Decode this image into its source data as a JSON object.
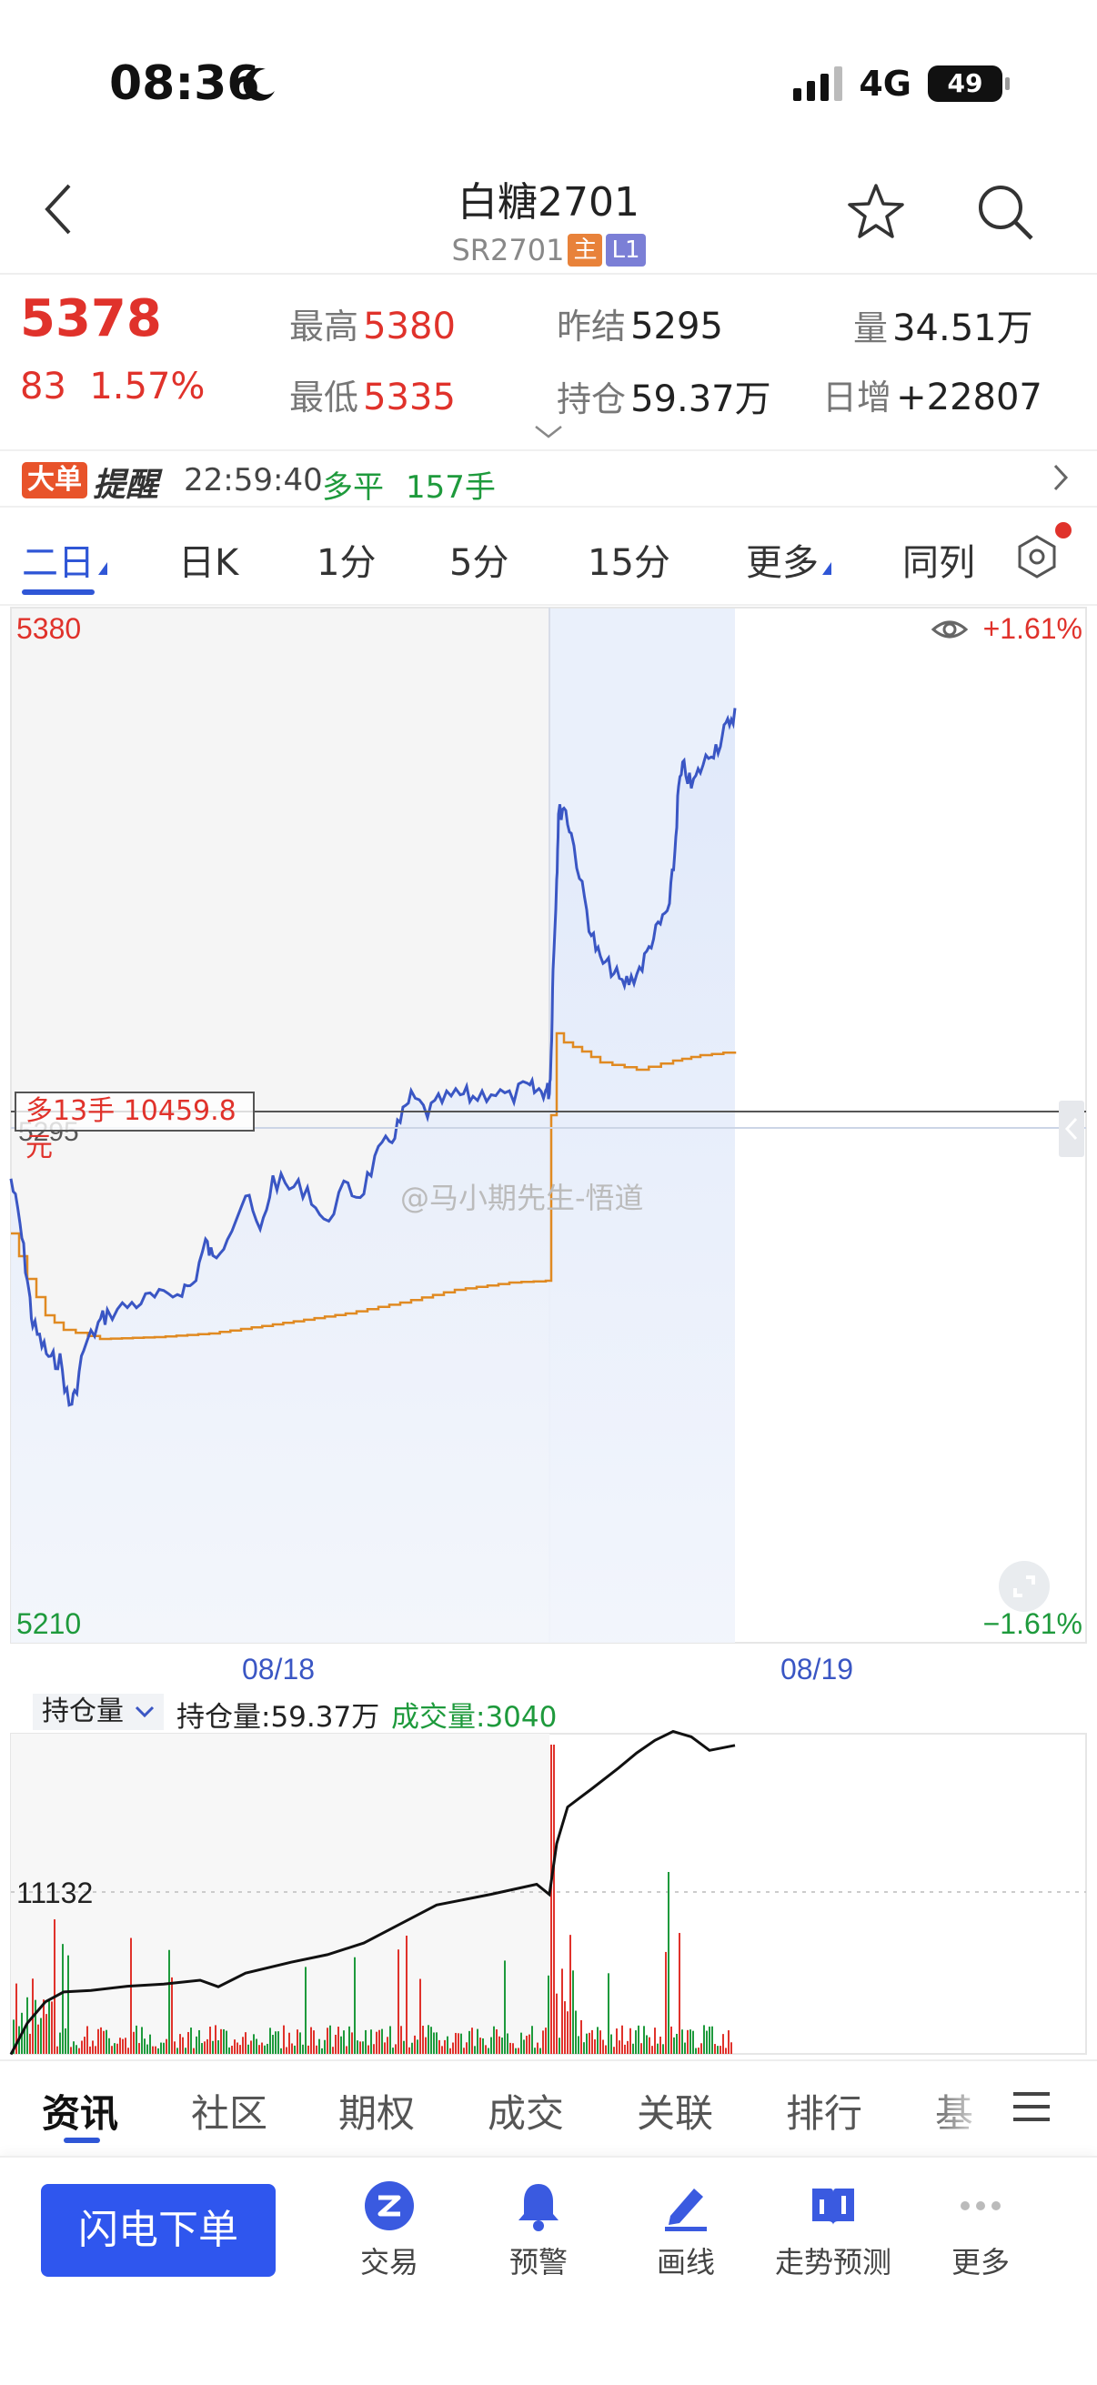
{
  "status": {
    "time": "08:36",
    "network": "4G",
    "battery": "49"
  },
  "header": {
    "title": "白糖2701",
    "code": "SR2701",
    "tag_main": "主",
    "tag_level": "L1"
  },
  "quote": {
    "price": "5378",
    "change": "83",
    "change_pct": "1.57%",
    "high_label": "最高",
    "high": "5380",
    "low_label": "最低",
    "low": "5335",
    "prev_settle_label": "昨结",
    "prev_settle": "5295",
    "open_interest_label": "持仓",
    "open_interest": "59.37万",
    "volume_label": "量",
    "volume": "34.51万",
    "daily_inc_label": "日增",
    "daily_inc": "+22807"
  },
  "alert": {
    "badge": "大单",
    "title": "提醒",
    "time": "22:59:40",
    "action": "多平",
    "lots": "157手"
  },
  "period_tabs": [
    "二日",
    "日K",
    "1分",
    "5分",
    "15分",
    "更多",
    "同列"
  ],
  "chart": {
    "y_top": "5380",
    "y_bottom": "5210",
    "pct_top": "+1.61%",
    "pct_bottom": "−1.61%",
    "ref_price": "5295",
    "dates": [
      "08/18",
      "08/19"
    ],
    "position_label": "多13手 10459.8元",
    "watermark": "@马小期先生-悟道",
    "colors": {
      "price": "#3a56c4",
      "avg": "#e08a22",
      "up": "#e0322b",
      "down": "#1e9a3c",
      "fill": "#e4ecfa"
    }
  },
  "chart_data": {
    "type": "line",
    "ylim": [
      5210,
      5380
    ],
    "series": [],
    "x": []
  },
  "indicator": {
    "select": "持仓量",
    "oi_text": "持仓量:59.37万",
    "vol_text": "成交量:3040",
    "axis_value": "11132"
  },
  "bottom_tabs": [
    "资讯",
    "社区",
    "期权",
    "成交",
    "关联",
    "排行",
    "基"
  ],
  "actions": {
    "order": "闪电下单",
    "items": [
      "交易",
      "预警",
      "画线",
      "走势预测",
      "更多"
    ]
  }
}
